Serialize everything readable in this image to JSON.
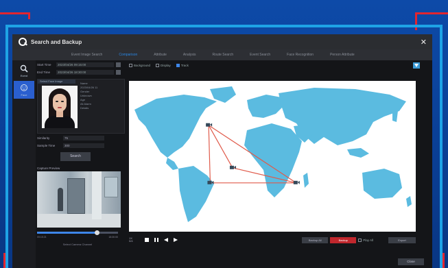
{
  "window": {
    "title": "Search and Backup",
    "close_label": "✕"
  },
  "tabs": [
    {
      "label": "Event Image Search"
    },
    {
      "label": "Comparison"
    },
    {
      "label": "Attribute"
    },
    {
      "label": "Analysis"
    },
    {
      "label": "Route Search"
    },
    {
      "label": "Event Search"
    },
    {
      "label": "Face Recognition"
    },
    {
      "label": "Person Attribute"
    }
  ],
  "sidebar": {
    "items": [
      {
        "label": "Event",
        "icon": "search-icon"
      },
      {
        "label": "Face",
        "icon": "face-icon"
      }
    ]
  },
  "search": {
    "start_label": "Start Time",
    "start_value": "2023/04/26 09:15:00",
    "end_label": "End Time",
    "end_value": "2023/04/26 18:30:00",
    "face_header": "Select Face Image",
    "info_lines": [
      "Name",
      "2023/04/26 11",
      "Gender",
      "Unknown",
      "Age",
      "All Alarm",
      "",
      "Details"
    ],
    "similarity_label": "Similarity",
    "similarity_value": "75",
    "sample_label": "Sample Time",
    "sample_value": "300",
    "search_button": "Search"
  },
  "camera": {
    "header": "Capture Preview",
    "progress_fraction": 0.74,
    "time_start": "09:15:21",
    "time_end": "18:30:00",
    "footer": "Select Camera Channel"
  },
  "options": [
    {
      "label": "Background",
      "checked": false
    },
    {
      "label": "Display",
      "checked": false
    },
    {
      "label": "Track",
      "checked": true
    }
  ],
  "map": {
    "land_color": "#5bbbe0",
    "route_color": "#e05a4a",
    "points": [
      {
        "lon": -80,
        "lat": 40
      },
      {
        "lon": -50,
        "lat": -8
      },
      {
        "lon": -78,
        "lat": -25
      },
      {
        "lon": 30,
        "lat": -25
      }
    ],
    "route": [
      [
        0,
        1
      ],
      [
        0,
        2
      ],
      [
        0,
        3
      ],
      [
        2,
        3
      ],
      [
        1,
        3
      ]
    ]
  },
  "playback": {
    "speed_label": "1X",
    "speed_sub": "0/4",
    "buttons": [
      {
        "label": "Backup All"
      },
      {
        "label": "Backup"
      },
      {
        "label": "Play All"
      },
      {
        "label": "Export"
      }
    ]
  },
  "footer_button": "Close"
}
